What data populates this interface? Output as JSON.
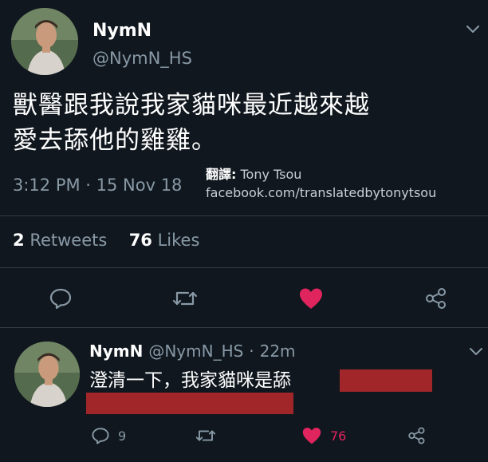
{
  "main_tweet": {
    "display_name": "NymN",
    "handle": "@NymN_HS",
    "text_line1": "獸醫跟我說我家貓咪最近越來越",
    "text_line2": "愛去舔他的雞雞。",
    "timestamp": "3:12 PM · 15 Nov 18",
    "credit": {
      "label": "翻譯:",
      "name": "Tony Tsou",
      "link": "facebook.com/translatedbytonytsou"
    },
    "stats": {
      "retweets_count": "2",
      "retweets_label": "Retweets",
      "likes_count": "76",
      "likes_label": "Likes"
    },
    "actions": [
      "reply-icon",
      "retweet-icon",
      "like-icon-filled",
      "share-icon"
    ]
  },
  "reply_tweet": {
    "display_name": "NymN",
    "handle": "@NymN_HS",
    "separator": "·",
    "age": "22m",
    "text": "澄清一下，我家貓咪是舔",
    "reply_count": "9",
    "like_count": "76"
  },
  "colors": {
    "background": "#10171e",
    "secondary_text": "#8899a6",
    "like_red": "#e0245e",
    "redaction": "#a0262a",
    "divider": "#2f3a44"
  }
}
